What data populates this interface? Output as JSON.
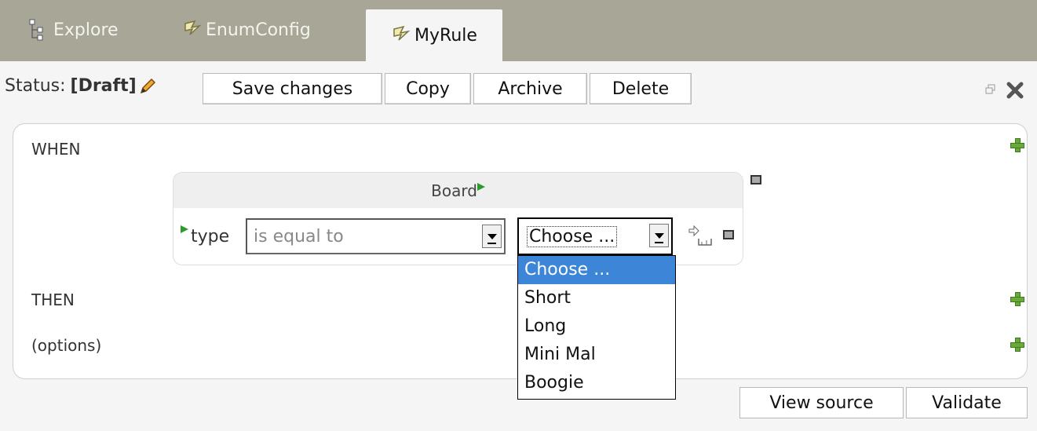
{
  "tabs": [
    {
      "label": "Explore",
      "icon": "explore-tree-icon"
    },
    {
      "label": "EnumConfig",
      "icon": "rule-icon"
    },
    {
      "label": "MyRule",
      "icon": "rule-icon",
      "active": true
    }
  ],
  "toolbar": {
    "status_prefix": "Status:",
    "status_value": "[Draft]",
    "save_label": "Save changes",
    "copy_label": "Copy",
    "archive_label": "Archive",
    "delete_label": "Delete"
  },
  "rule": {
    "when_label": "WHEN",
    "then_label": "THEN",
    "options_label": "(options)",
    "pattern": {
      "fact": "Board",
      "field": "type",
      "operator": "is equal to",
      "value": "Choose ..."
    },
    "dropdown": {
      "options": [
        "Choose ...",
        "Short",
        "Long",
        "Mini Mal",
        "Boogie"
      ],
      "selected_index": 0
    }
  },
  "footer": {
    "view_source_label": "View source",
    "validate_label": "Validate"
  },
  "colors": {
    "tab_bar": "#a7a697",
    "selected_option": "#3d86d7",
    "plus_green": "#6aa83a"
  }
}
